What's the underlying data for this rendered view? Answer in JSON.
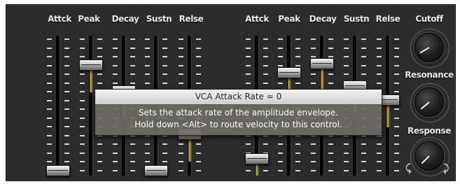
{
  "synth_panel": {
    "vca_faders": [
      {
        "label": "Attck",
        "value": 0.0
      },
      {
        "label": "Peak",
        "value": 0.82
      },
      {
        "label": "Decay",
        "value": 0.62
      },
      {
        "label": "Sustn",
        "value": 0.0
      },
      {
        "label": "Relse",
        "value": 0.28
      }
    ],
    "vcf_faders": [
      {
        "label": "Attck",
        "value": 0.09
      },
      {
        "label": "Peak",
        "value": 0.76
      },
      {
        "label": "Decay",
        "value": 0.83
      },
      {
        "label": "Sustn",
        "value": 0.66
      },
      {
        "label": "Relse",
        "value": 0.55
      }
    ],
    "knobs": {
      "cutoff": {
        "label": "Cutoff"
      },
      "resonance": {
        "label": "Resonance"
      },
      "response": {
        "label": "Response"
      }
    }
  },
  "tooltip": {
    "title": "VCA Attack Rate = 0",
    "line1": "Sets the attack rate of the amplitude envelope.",
    "line2": "Hold down <Alt> to route velocity to this control."
  },
  "colors": {
    "panel": "#2b2b2b",
    "fill_accent": "#c7a94a",
    "label_text": "#e8e8e8"
  }
}
